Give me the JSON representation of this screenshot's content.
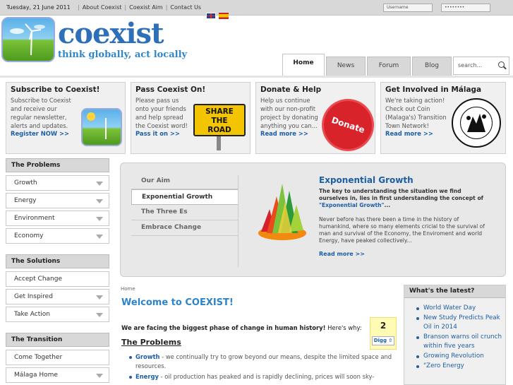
{
  "topbar": {
    "date": "Tuesday, 21 June 2011",
    "links": [
      "About Coexist",
      "Coexist Aim",
      "Contact Us"
    ],
    "username_placeholder": "Username",
    "password_mask": "••••••••"
  },
  "header": {
    "logo_text": "coexist",
    "tagline": "think globally, act locally"
  },
  "nav": {
    "tabs": [
      "Home",
      "News",
      "Forum",
      "Blog"
    ],
    "active": "Home",
    "search_placeholder": "search..."
  },
  "promos": [
    {
      "title": "Subscribe to Coexist!",
      "text": "Subscribe to Coexist and receive our regular newsletter, alerts and updates.",
      "link": "Register NOW >>"
    },
    {
      "title": "Pass Coexist On!",
      "text": "Please pass us onto your friends and help spread the Coexist word!",
      "link": "Pass it on >>",
      "sign": [
        "SHARE",
        "THE",
        "ROAD"
      ]
    },
    {
      "title": "Donate & Help",
      "text": "Help us continue with our non-profit project by donating anything you can...",
      "link": "Read more >>",
      "badge": "Donate"
    },
    {
      "title": "Get Involved in Málaga",
      "text": "We're taking action! Check out Coin (Malaga's) Transition Town Network!",
      "link": "Read more >>",
      "seal": "Coín en Transición"
    }
  ],
  "sidebar": {
    "sections": [
      {
        "title": "The Problems",
        "items": [
          "Growth",
          "Energy",
          "Environment",
          "Economy"
        ]
      },
      {
        "title": "The Solutions",
        "items": [
          "Accept Change",
          "Get Inspired",
          "Take Action"
        ]
      },
      {
        "title": "The Transition",
        "items": [
          "Come Together",
          "Málaga Home"
        ]
      }
    ]
  },
  "slider": {
    "menu": [
      "Our Aim",
      "Exponential Growth",
      "The Three Es",
      "Embrace Change"
    ],
    "active": "Exponential Growth",
    "title": "Exponential Growth",
    "lead": "The key to understanding the situation we find ourselves in, lies in first understanding the concept of",
    "lead_link": "\"Exponential Growth\"",
    "lead_end": "...",
    "body": "Never before has there been a time in the history of humankind, where so many elements cricial to the survival of man and survival of the Economy, the Enviroment and world Energy, have peaked collectively...",
    "more": "Read more >>"
  },
  "main": {
    "breadcrumb": "Home",
    "heading": "Welcome to COEXIST!",
    "intro_bold": "We are facing the biggest phase of change in human history!",
    "intro_rest": " Here's why:",
    "digg_count": "2",
    "digg_label": "Digg",
    "problems_heading": "The Problems",
    "problems": [
      {
        "term": "Growth",
        "text": " - we continually try to grow beyond our means, despite the limited space and resources."
      },
      {
        "term": "Energy",
        "text": " - oil production has peaked and is rapidly declining, prices will soon sky-"
      }
    ]
  },
  "latest": {
    "title": "What's the latest?",
    "items": [
      "World Water Day",
      "New Study Predicts Peak Oil in 2014",
      "Branson warns oil crunch within five years",
      "Growing Revolution",
      "\"Zero Energy"
    ]
  },
  "colors": {
    "brand_blue": "#1c5ea6",
    "heading_blue": "#2d84c8",
    "panel_gray": "#d8d8d8",
    "donate_red": "#d8232a",
    "sign_yellow": "#f2c500"
  }
}
